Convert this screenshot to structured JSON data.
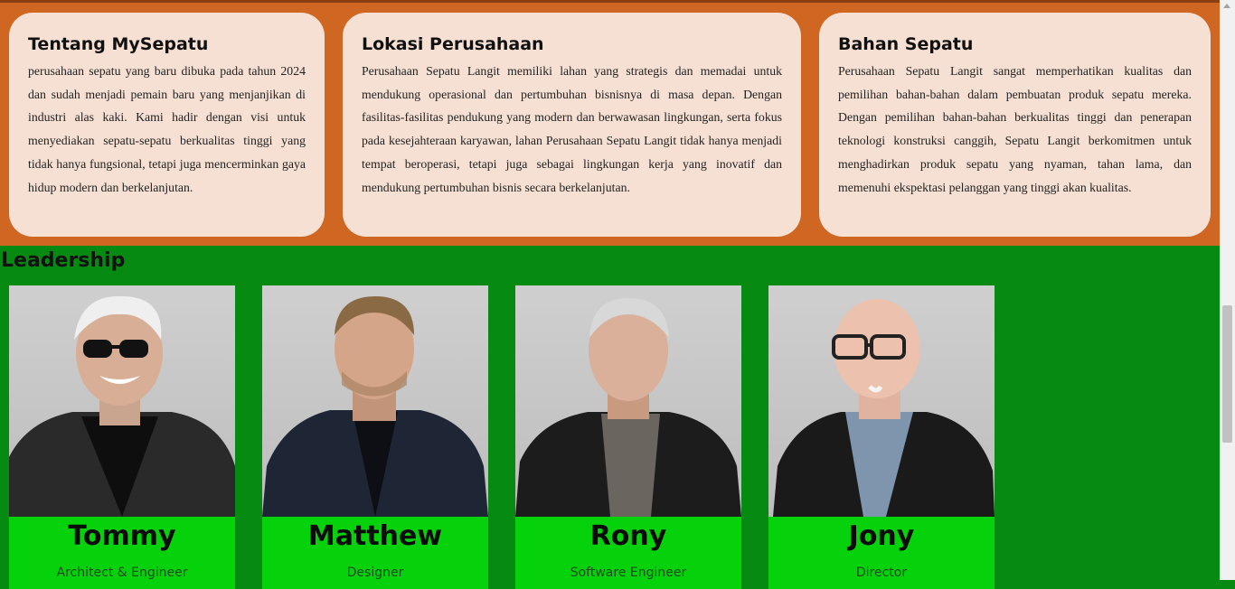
{
  "about_cards": [
    {
      "title": "Tentang MySepatu",
      "text": "perusahaan sepatu yang baru dibuka pada tahun 2024 dan sudah menjadi pemain baru yang menjanjikan di industri alas kaki. Kami hadir dengan visi untuk menyediakan sepatu-sepatu berkualitas tinggi yang tidak hanya fungsional, tetapi juga mencerminkan gaya hidup modern dan berkelanjutan."
    },
    {
      "title": "Lokasi Perusahaan",
      "text": "Perusahaan Sepatu Langit memiliki lahan yang strategis dan memadai untuk mendukung operasional dan pertumbuhan bisnisnya di masa depan. Dengan fasilitas-fasilitas pendukung yang modern dan berwawasan lingkungan, serta fokus pada kesejahteraan karyawan, lahan Perusahaan Sepatu Langit tidak hanya menjadi tempat beroperasi, tetapi juga sebagai lingkungan kerja yang inovatif dan mendukung pertumbuhan bisnis secara berkelanjutan."
    },
    {
      "title": "Bahan Sepatu",
      "text": "Perusahaan Sepatu Langit sangat memperhatikan kualitas dan pemilihan bahan-bahan dalam pembuatan produk sepatu mereka. Dengan pemilihan bahan-bahan berkualitas tinggi dan penerapan teknologi konstruksi canggih, Sepatu Langit berkomitmen untuk menghadirkan produk sepatu yang nyaman, tahan lama, dan memenuhi ekspektasi pelanggan yang tinggi akan kualitas."
    }
  ],
  "leadership": {
    "title": "Leadership",
    "members": [
      {
        "name": "Tommy",
        "role": "Architect & Engineer"
      },
      {
        "name": "Matthew",
        "role": "Designer"
      },
      {
        "name": "Rony",
        "role": "Software Engineer"
      },
      {
        "name": "Jony",
        "role": "Director"
      }
    ]
  },
  "colors": {
    "top_section_bg": "#cf6622",
    "card_bg": "#f6e0d3",
    "leadership_bg": "#078a12",
    "name_box_bg": "#05d20a"
  }
}
